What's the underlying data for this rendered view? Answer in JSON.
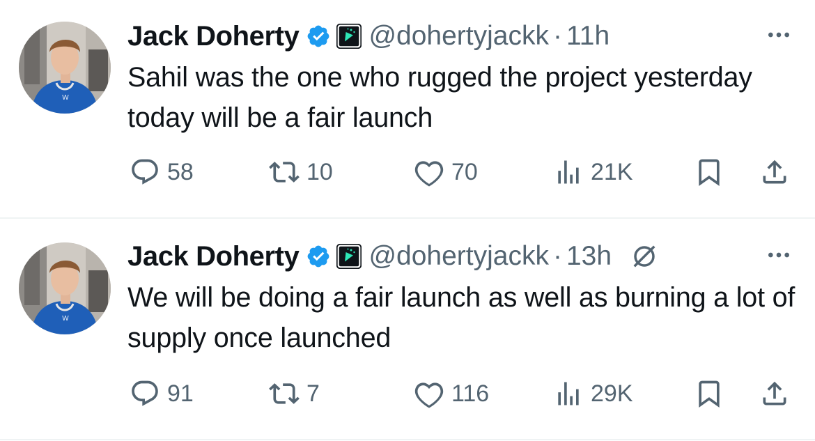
{
  "tweets": [
    {
      "name": "Jack Doherty",
      "handle": "@dohertyjackk",
      "separator": "·",
      "time": "11h",
      "text": "Sahil was the one who rugged the project yesterday today will be a fair launch",
      "replies": "58",
      "reposts": "10",
      "likes": "70",
      "views": "21K"
    },
    {
      "name": "Jack Doherty",
      "handle": "@dohertyjackk",
      "separator": "·",
      "time": "13h",
      "text": "We will be doing a fair launch as well as burning a lot of supply once launched",
      "replies": "91",
      "reposts": "7",
      "likes": "116",
      "views": "29K"
    }
  ],
  "colors": {
    "verified": "#1d9bf0",
    "muted": "#536471",
    "text": "#0f1419",
    "affiliate_bg": "#0f1419",
    "affiliate_accent": "#2ee6b6"
  },
  "icons": [
    "verified-badge-icon",
    "affiliate-badge-icon",
    "no-reply-icon",
    "more-icon",
    "reply-icon",
    "repost-icon",
    "like-icon",
    "views-icon",
    "bookmark-icon",
    "share-icon"
  ]
}
